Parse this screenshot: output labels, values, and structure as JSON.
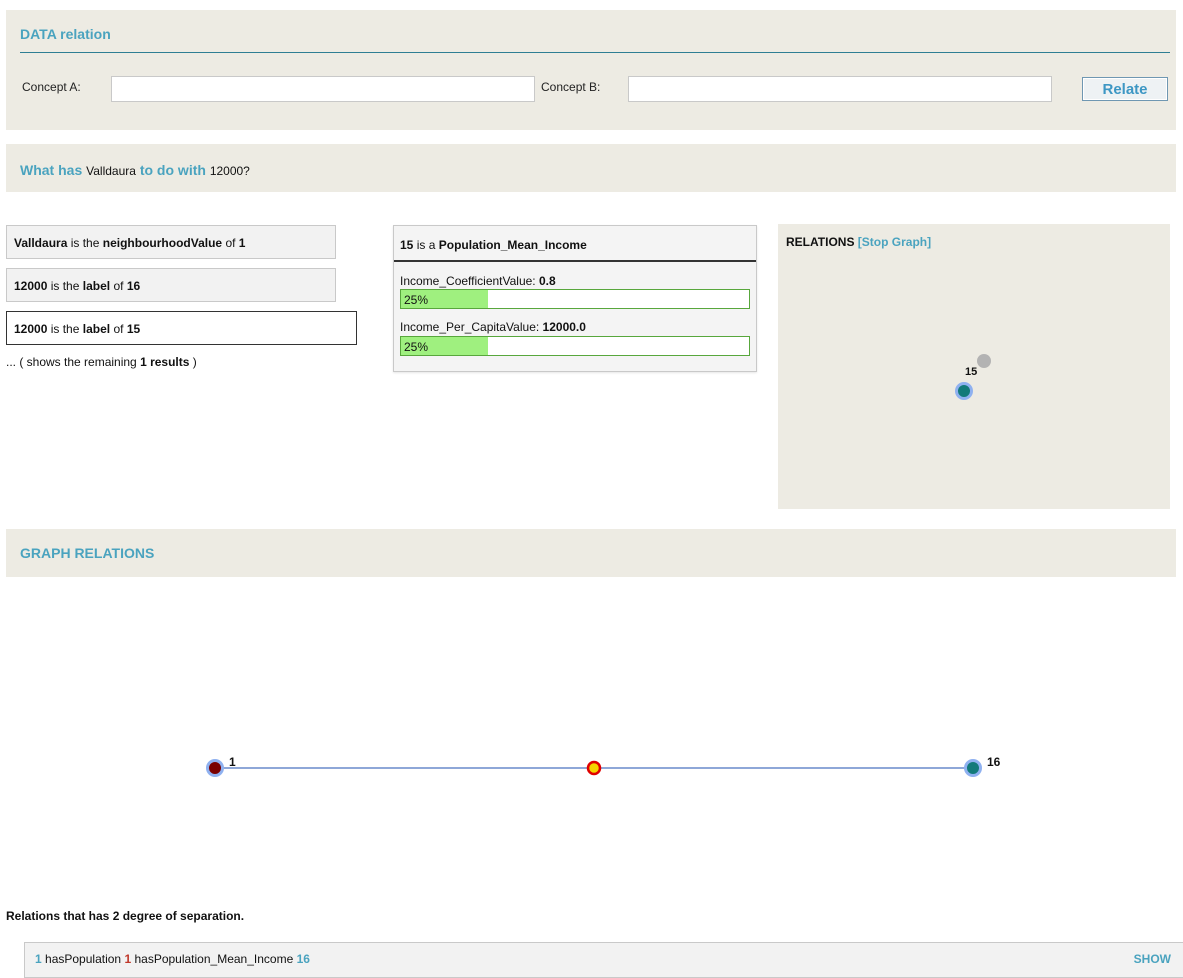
{
  "data_relation": {
    "title": "DATA relation",
    "concept_a_label": "Concept A:",
    "concept_a_value": "",
    "concept_b_label": "Concept B:",
    "concept_b_value": "",
    "relate_label": "Relate"
  },
  "question": {
    "prefix": "What has",
    "concept_a": "Valldaura",
    "middle": "to do with",
    "concept_b": "12000?"
  },
  "results": [
    {
      "subject": "Valldaura",
      "text": "is the",
      "predicate": "neighbourhoodValue",
      "of": "of",
      "object": "1"
    },
    {
      "subject": "12000",
      "text": "is the",
      "predicate": "label",
      "of": "of",
      "object": "16"
    },
    {
      "subject": "12000",
      "text": "is the",
      "predicate": "label",
      "of": "of",
      "object": "15"
    }
  ],
  "remaining": {
    "prefix": "... ( shows the remaining",
    "count": "1 results",
    "suffix": ")"
  },
  "entity": {
    "id": "15",
    "is_a": "is a",
    "type": "Population_Mean_Income",
    "properties": [
      {
        "name": "Income_CoefficientValue:",
        "value": "0.8",
        "bar_label": "25%",
        "fill_fraction": 0.25
      },
      {
        "name": "Income_Per_CapitaValue:",
        "value": "12000.0",
        "bar_label": "25%",
        "fill_fraction": 0.25
      }
    ]
  },
  "relations_panel": {
    "title": "RELATIONS",
    "stop_label": "[Stop Graph]",
    "node_label": "15"
  },
  "graph_relations": {
    "title": "GRAPH RELATIONS",
    "nodes": [
      {
        "label": "1",
        "color": "#7a0000"
      },
      {
        "label": "",
        "color": "#f5d400"
      },
      {
        "label": "16",
        "color": "#137a7a"
      }
    ]
  },
  "separation": {
    "text": "Relations that has 2 degree of separation.",
    "path": {
      "start": "1",
      "rel1": "hasPopulation",
      "mid": "1",
      "rel2": "hasPopulation_Mean_Income",
      "end": "16"
    },
    "show_label": "SHOW"
  },
  "colors": {
    "accent": "#4aa3bf",
    "panel_bg": "#edebe3",
    "bar_fill": "#9ff07f",
    "bar_border": "#58a73c"
  }
}
